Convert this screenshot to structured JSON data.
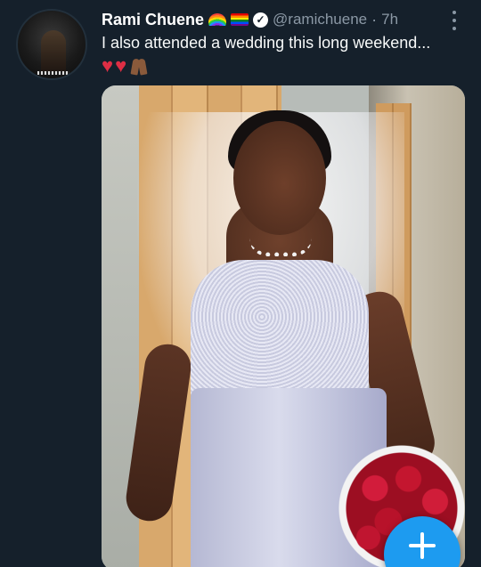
{
  "tweet": {
    "author_name": "Rami Chuene",
    "author_flags": [
      "rainbow-icon",
      "pride-flag-icon",
      "verified-icon"
    ],
    "handle": "@ramichuene",
    "separator": "·",
    "time": "7h",
    "text": "I also attended a wedding this long weekend...",
    "emojis": [
      "red-heart-icon",
      "red-heart-icon",
      "folded-hands-icon"
    ],
    "media_alt": "wedding-photo"
  },
  "fab": {
    "icon": "plus-icon"
  },
  "colors": {
    "background": "#15202b",
    "secondary_text": "#8b98a5",
    "accent": "#1d9bf0"
  }
}
